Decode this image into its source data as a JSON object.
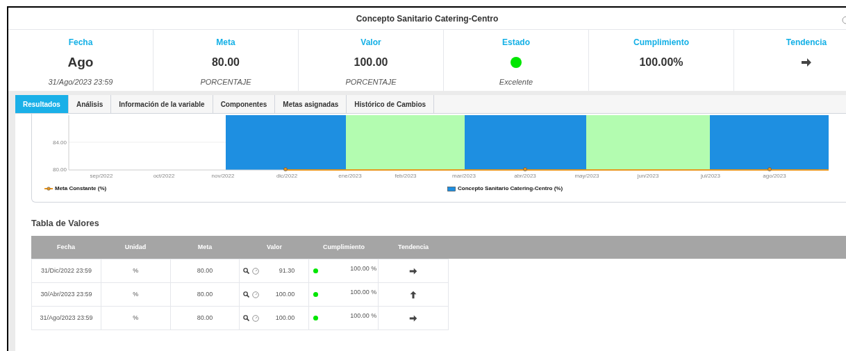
{
  "window": {
    "title": "Concepto Sanitario Catering-Centro"
  },
  "kpis": [
    {
      "label": "Fecha",
      "value": "Ago",
      "sub": "31/Ago/2023 23:59",
      "kind": "text"
    },
    {
      "label": "Meta",
      "value": "80.00",
      "sub": "PORCENTAJE",
      "kind": "text"
    },
    {
      "label": "Valor",
      "value": "100.00",
      "sub": "PORCENTAJE",
      "kind": "text"
    },
    {
      "label": "Estado",
      "color": "#00e600",
      "sub": "Excelente",
      "kind": "status"
    },
    {
      "label": "Cumplimiento",
      "value": "100.00%",
      "kind": "text"
    },
    {
      "label": "Tendencia",
      "arrow": {
        "kind": "right"
      },
      "kind": "trend"
    }
  ],
  "tabs": [
    {
      "label": "Resultados",
      "selected": true
    },
    {
      "label": "Análisis",
      "selected": false
    },
    {
      "label": "Información de la variable",
      "selected": false
    },
    {
      "label": "Componentes",
      "selected": false
    },
    {
      "label": "Metas asignadas",
      "selected": false
    },
    {
      "label": "Histórico de Cambios",
      "selected": false
    }
  ],
  "chart": {
    "y_labels": [
      "84.00",
      "80.00"
    ],
    "x_labels": [
      "sep/2022",
      "oct/2022",
      "nov/2022",
      "dic/2022",
      "ene/2023",
      "feb/2023",
      "mar/2023",
      "abr/2023",
      "may/2023",
      "jun/2023",
      "jul/2023",
      "ago/2023"
    ],
    "legend": [
      {
        "label": "Meta Constante (%)",
        "kind": "line"
      },
      {
        "label": "Concepto Sanitario Catering-Centro (%)",
        "kind": "bar"
      }
    ]
  },
  "table": {
    "title": "Tabla de Valores",
    "columns": [
      "Fecha",
      "Unidad",
      "Meta",
      "Valor",
      "Cumplimiento",
      "Tendencia"
    ],
    "rows": [
      {
        "fecha": "31/Dic/2022 23:59",
        "unidad": "%",
        "meta": "80.00",
        "valor": "91.30",
        "color": "#00e600",
        "cumplimiento": "100.00 %",
        "arrow": {
          "kind": "right"
        }
      },
      {
        "fecha": "30/Abr/2023 23:59",
        "unidad": "%",
        "meta": "80.00",
        "valor": "100.00",
        "color": "#00e600",
        "cumplimiento": "100.00 %",
        "arrow": {
          "kind": "up"
        }
      },
      {
        "fecha": "31/Ago/2023 23:59",
        "unidad": "%",
        "meta": "80.00",
        "valor": "100.00",
        "color": "#00e600",
        "cumplimiento": "100.00 %",
        "arrow": {
          "kind": "right"
        }
      }
    ]
  }
}
